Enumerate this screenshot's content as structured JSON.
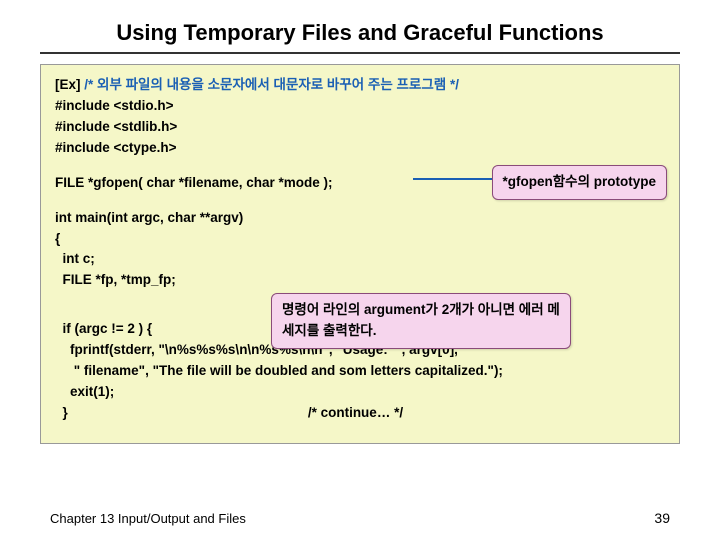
{
  "title": "Using Temporary Files and Graceful Functions",
  "code": {
    "l1a": "[Ex] ",
    "l1b": "/* 외부 파일의 내용을 소문자에서 대문자로 바꾸어 주는 프로그램 */",
    "l2": "#include <stdio.h>",
    "l3": "#include <stdlib.h>",
    "l4": "#include <ctype.h>",
    "l5": "FILE *gfopen( char *filename, char *mode );",
    "l6": "int main(int argc, char **argv)",
    "l7": "{",
    "l8": "  int c;",
    "l9": "  FILE *fp, *tmp_fp;",
    "l10": "  if (argc != 2 ) {",
    "l11": "    fprintf(stderr, \"\\n%s%s%s\\n\\n%s%s\\n\\n\", \"Usage:  \", argv[0],",
    "l12": "     \" filename\", \"The file will be doubled and som letters capitalized.\");",
    "l13": "    exit(1);",
    "l14a": "  }",
    "l14b": "                                                                /* continue… */"
  },
  "callout1": "*gfopen함수의 prototype",
  "callout2": "명령어 라인의 argument가 2개가 아니면 에러 메세지를 출력한다.",
  "footer": "Chapter 13  Input/Output and Files",
  "pagenum": "39"
}
